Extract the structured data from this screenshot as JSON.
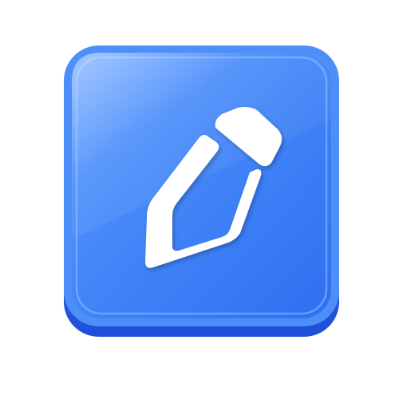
{
  "icon": {
    "semantic": "pencil-edit-icon",
    "colors": {
      "base_dark": "#1f4fd8",
      "base_mid": "#3b7bf5",
      "base_light": "#6aa6ff",
      "face_top": "#5a9bff",
      "face_bottom": "#2f6ff0",
      "rim": "#8fc0ff",
      "glyph": "#ffffff"
    }
  }
}
